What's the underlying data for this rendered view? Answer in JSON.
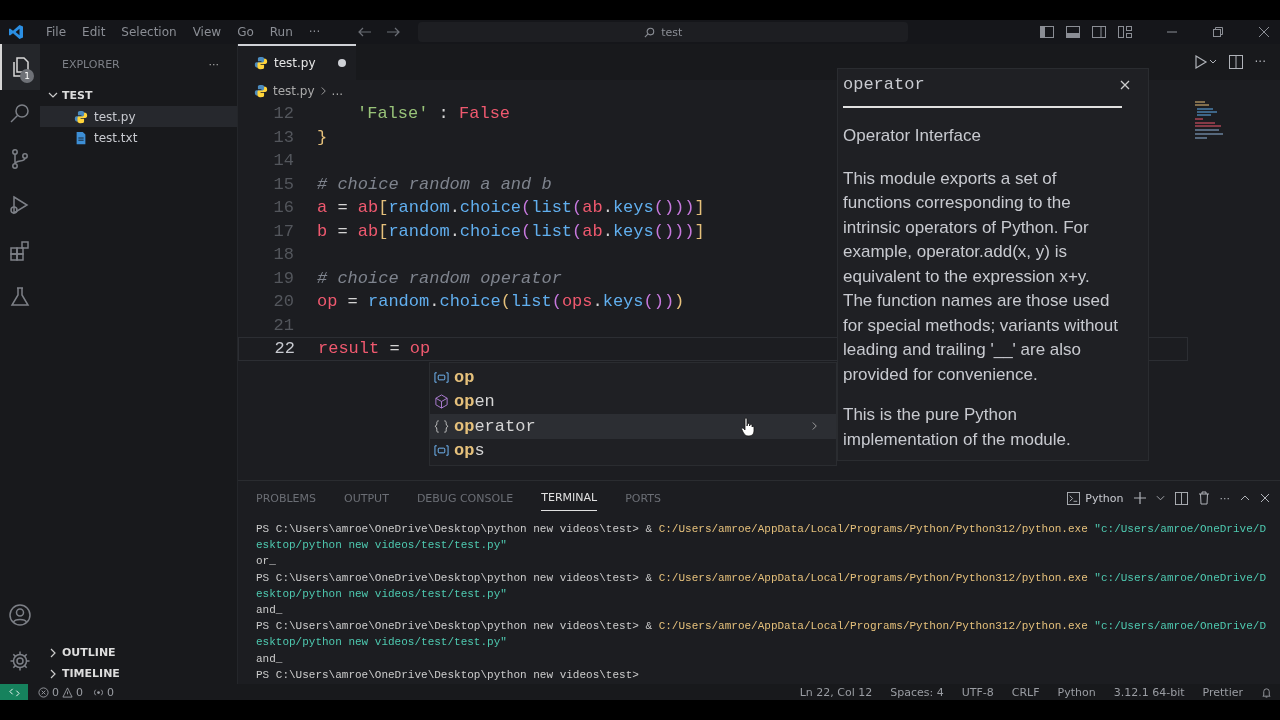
{
  "title_bar": {
    "menu": [
      "File",
      "Edit",
      "Selection",
      "View",
      "Go",
      "Run",
      "···"
    ],
    "search": "test"
  },
  "activity_bar": {
    "items": [
      {
        "kind": "files",
        "selected": true,
        "badge": "1"
      },
      {
        "kind": "search",
        "selected": false
      },
      {
        "kind": "branch",
        "selected": false
      },
      {
        "kind": "run",
        "selected": false
      },
      {
        "kind": "extensions",
        "selected": false
      },
      {
        "kind": "flask",
        "selected": false
      }
    ],
    "bottom": [
      {
        "kind": "account"
      },
      {
        "kind": "gear"
      }
    ]
  },
  "sidebar": {
    "title": "EXPLORER",
    "more": "···",
    "folder": {
      "name": "TEST",
      "expanded": true,
      "children": [
        {
          "name": "test.py",
          "kind": "python",
          "selected": true
        },
        {
          "name": "test.txt",
          "kind": "text",
          "selected": false
        }
      ]
    },
    "sections": [
      {
        "name": "OUTLINE",
        "expanded": false
      },
      {
        "name": "TIMELINE",
        "expanded": false
      }
    ]
  },
  "editor": {
    "tabs": [
      {
        "label": "test.py",
        "selected": true,
        "modified": true
      }
    ],
    "more": "···",
    "breadcrumb": [
      "test.py",
      "..."
    ],
    "lines": [
      {
        "number": "12",
        "current": false,
        "tokens": [
          {
            "text": "'False'",
            "kind": "string"
          },
          {
            "text": " : ",
            "kind": "plain"
          },
          {
            "text": "False",
            "kind": "var"
          }
        ]
      },
      {
        "number": "13",
        "current": false,
        "tokens": [
          {
            "text": "}",
            "kind": "brace"
          }
        ]
      },
      {
        "number": "14",
        "current": false
      },
      {
        "number": "15",
        "current": false,
        "tokens": [
          {
            "text": "# choice random a and b",
            "kind": "comment"
          }
        ]
      },
      {
        "number": "16",
        "current": false,
        "tokens": [
          {
            "text": "a",
            "kind": "var"
          },
          {
            "text": " = ",
            "kind": "plain"
          },
          {
            "text": "ab",
            "kind": "var"
          },
          {
            "text": "[",
            "kind": "brace"
          },
          {
            "text": "random",
            "kind": "fn"
          },
          {
            "text": ".",
            "kind": "plain"
          },
          {
            "text": "choice",
            "kind": "fn"
          },
          {
            "text": "(",
            "kind": "paren"
          },
          {
            "text": "list",
            "kind": "fn"
          },
          {
            "text": "(",
            "kind": "paren"
          },
          {
            "text": "ab",
            "kind": "var"
          },
          {
            "text": ".",
            "kind": "plain"
          },
          {
            "text": "keys",
            "kind": "fn"
          },
          {
            "text": "()))",
            "kind": "paren"
          },
          {
            "text": "]",
            "kind": "brace"
          }
        ]
      },
      {
        "number": "17",
        "current": false,
        "tokens": [
          {
            "text": "b",
            "kind": "var"
          },
          {
            "text": " = ",
            "kind": "plain"
          },
          {
            "text": "ab",
            "kind": "var"
          },
          {
            "text": "[",
            "kind": "brace"
          },
          {
            "text": "random",
            "kind": "fn"
          },
          {
            "text": ".",
            "kind": "plain"
          },
          {
            "text": "choice",
            "kind": "fn"
          },
          {
            "text": "(",
            "kind": "paren"
          },
          {
            "text": "list",
            "kind": "fn"
          },
          {
            "text": "(",
            "kind": "paren"
          },
          {
            "text": "ab",
            "kind": "var"
          },
          {
            "text": ".",
            "kind": "plain"
          },
          {
            "text": "keys",
            "kind": "fn"
          },
          {
            "text": "()))",
            "kind": "paren"
          },
          {
            "text": "]",
            "kind": "brace"
          }
        ]
      },
      {
        "number": "18",
        "current": false
      },
      {
        "number": "19",
        "current": false,
        "tokens": [
          {
            "text": "# choice random operator",
            "kind": "comment"
          }
        ]
      },
      {
        "number": "20",
        "current": false,
        "tokens": [
          {
            "text": "op",
            "kind": "var"
          },
          {
            "text": " = ",
            "kind": "plain"
          },
          {
            "text": "random",
            "kind": "fn"
          },
          {
            "text": ".",
            "kind": "plain"
          },
          {
            "text": "choice",
            "kind": "fn"
          },
          {
            "text": "(",
            "kind": "brace"
          },
          {
            "text": "list",
            "kind": "fn"
          },
          {
            "text": "(",
            "kind": "paren"
          },
          {
            "text": "ops",
            "kind": "var"
          },
          {
            "text": ".",
            "kind": "plain"
          },
          {
            "text": "keys",
            "kind": "fn"
          },
          {
            "text": "())",
            "kind": "paren"
          },
          {
            "text": ")",
            "kind": "brace"
          }
        ]
      },
      {
        "number": "21",
        "current": false
      },
      {
        "number": "22",
        "current": true,
        "tokens": [
          {
            "text": "result",
            "kind": "var"
          },
          {
            "text": " = ",
            "kind": "plain"
          },
          {
            "text": "op",
            "kind": "var"
          }
        ]
      }
    ],
    "suggestions": [
      {
        "kind": "variable",
        "match": "op",
        "selected": false
      },
      {
        "kind": "module",
        "match": "op",
        "rest": "en",
        "selected": false
      },
      {
        "kind": "namespace",
        "match": "op",
        "rest": "erator",
        "selected": true
      },
      {
        "kind": "variable",
        "match": "op",
        "rest": "s",
        "selected": false
      }
    ],
    "hover": {
      "title": "operator",
      "heading": "Operator Interface",
      "paragraphs": [
        "This module exports a set of functions corresponding to the intrinsic operators of Python. For example, operator.add(x, y) is equivalent to the expression x+y. The function names are those used for special methods; variants without leading and trailing '__' are also provided for convenience.",
        "This is the pure Python implementation of the module."
      ]
    }
  },
  "panel": {
    "tabs": [
      {
        "label": "PROBLEMS",
        "selected": false
      },
      {
        "label": "OUTPUT",
        "selected": false
      },
      {
        "label": "DEBUG CONSOLE",
        "selected": false
      },
      {
        "label": "TERMINAL",
        "selected": true
      },
      {
        "label": "PORTS",
        "selected": false
      }
    ],
    "terminal_name": "Python",
    "more": "···",
    "terminal": [
      [
        {
          "text": "PS C:\\Users\\amroe\\OneDrive\\Desktop\\python new videos\\test> & ",
          "kind": "plain"
        },
        {
          "text": "C:/Users/amroe/AppData/Local/Programs/Python/Python312/python.exe",
          "kind": "path"
        },
        {
          "text": " \"c:/Users/amroe/OneDrive/D",
          "kind": "string"
        }
      ],
      [
        {
          "text": "esktop/python new videos/test/test.py\"",
          "kind": "string"
        }
      ],
      [
        {
          "text": "or_",
          "kind": "plain"
        }
      ],
      [
        {
          "text": "PS C:\\Users\\amroe\\OneDrive\\Desktop\\python new videos\\test> & ",
          "kind": "plain"
        },
        {
          "text": "C:/Users/amroe/AppData/Local/Programs/Python/Python312/python.exe",
          "kind": "path"
        },
        {
          "text": " \"c:/Users/amroe/OneDrive/D",
          "kind": "string"
        }
      ],
      [
        {
          "text": "esktop/python new videos/test/test.py\"",
          "kind": "string"
        }
      ],
      [
        {
          "text": "and_",
          "kind": "plain"
        }
      ],
      [
        {
          "text": "PS C:\\Users\\amroe\\OneDrive\\Desktop\\python new videos\\test> & ",
          "kind": "plain"
        },
        {
          "text": "C:/Users/amroe/AppData/Local/Programs/Python/Python312/python.exe",
          "kind": "path"
        },
        {
          "text": " \"c:/Users/amroe/OneDrive/D",
          "kind": "string"
        }
      ],
      [
        {
          "text": "esktop/python new videos/test/test.py\"",
          "kind": "string"
        }
      ],
      [
        {
          "text": "and_",
          "kind": "plain"
        }
      ],
      [
        {
          "text": "PS C:\\Users\\amroe\\OneDrive\\Desktop\\python new videos\\test>",
          "kind": "plain"
        }
      ]
    ]
  },
  "status_bar": {
    "errors": "0",
    "warnings": "0",
    "ports": "0",
    "right": [
      "Ln 22, Col 12",
      "Spaces: 4",
      "UTF-8",
      "CRLF",
      "Python",
      "3.12.1 64-bit",
      "Prettier"
    ]
  }
}
